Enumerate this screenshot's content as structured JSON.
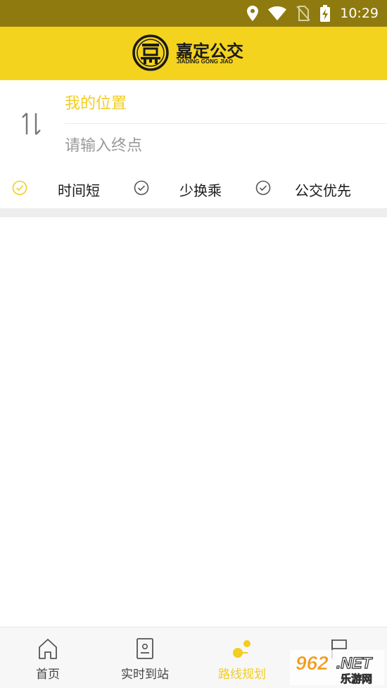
{
  "status_bar": {
    "time": "10:29",
    "icons": [
      "location-icon",
      "wifi-icon",
      "no-sim-icon",
      "battery-charging-icon"
    ]
  },
  "header": {
    "logo_cn": "嘉定公交",
    "logo_en": "JIADING GONG JIAO",
    "brand_color": "#f4d31f"
  },
  "route": {
    "origin": "我的位置",
    "destination_placeholder": "请输入终点",
    "swap_icon": "swap-vertical-icon"
  },
  "options": [
    {
      "label": "时间短",
      "selected": true
    },
    {
      "label": "少换乘",
      "selected": false
    },
    {
      "label": "公交优先",
      "selected": false
    }
  ],
  "bottom_nav": [
    {
      "label": "首页",
      "icon": "home-icon",
      "active": false
    },
    {
      "label": "实时到站",
      "icon": "realtime-arrival-icon",
      "active": false
    },
    {
      "label": "路线规划",
      "icon": "route-plan-icon",
      "active": true
    },
    {
      "label": "",
      "icon": "flag-icon",
      "active": false
    }
  ],
  "watermark": {
    "text": "962.NET",
    "subtext": "乐游网"
  },
  "colors": {
    "status_bar": "#8e7a0e",
    "accent": "#f2cd22",
    "text": "#1a1a1a",
    "placeholder": "#9a9a9a"
  }
}
